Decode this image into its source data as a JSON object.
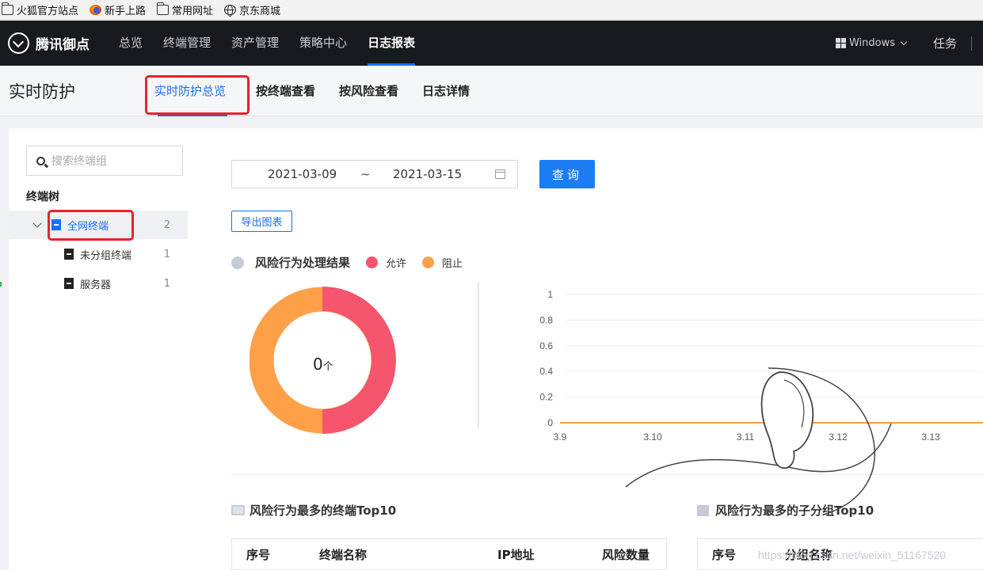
{
  "bookmarks": [
    {
      "label": "火狐官方站点",
      "icon": "folder-icon"
    },
    {
      "label": "新手上路",
      "icon": "firefox-icon"
    },
    {
      "label": "常用网址",
      "icon": "folder-icon"
    },
    {
      "label": "京东商城",
      "icon": "globe-icon"
    }
  ],
  "header": {
    "brand": "腾讯御点",
    "nav": [
      {
        "label": "总览"
      },
      {
        "label": "终端管理"
      },
      {
        "label": "资产管理"
      },
      {
        "label": "策略中心"
      },
      {
        "label": "日志报表",
        "active": true
      }
    ],
    "os_select": "Windows",
    "task": "任务"
  },
  "subheader": {
    "title": "实时防护",
    "tabs": [
      {
        "label": "实时防护总览",
        "active": true
      },
      {
        "label": "按终端查看"
      },
      {
        "label": "按风险查看"
      },
      {
        "label": "日志详情"
      }
    ]
  },
  "sidebar": {
    "search_placeholder": "搜索终端组",
    "tree_title": "终端树",
    "nodes": [
      {
        "label": "全网终端",
        "count": "2",
        "selected": true
      },
      {
        "label": "未分组终端",
        "count": "1"
      },
      {
        "label": "服务器",
        "count": "1"
      }
    ]
  },
  "filters": {
    "start_date": "2021-03-09",
    "separator": "~",
    "end_date": "2021-03-15",
    "query_label": "查询",
    "export_label": "导出图表"
  },
  "risk_section": {
    "title": "风险行为处理结果",
    "legend": [
      {
        "label": "允许",
        "color": "#f5556d"
      },
      {
        "label": "阻止",
        "color": "#fda047"
      }
    ],
    "donut_value": "0",
    "donut_unit": "个"
  },
  "chart_data": {
    "type": "line",
    "x": [
      "3.9",
      "3.10",
      "3.11",
      "3.12",
      "3.13"
    ],
    "series": [
      {
        "values": [
          0,
          0,
          0,
          0,
          0
        ],
        "color": "#fda047"
      }
    ],
    "yticks": [
      "1",
      "0.8",
      "0.6",
      "0.4",
      "0.2",
      "0"
    ],
    "ylim": [
      0,
      1
    ],
    "grid": true
  },
  "top_terminals": {
    "title": "风险行为最多的终端Top10",
    "columns": [
      "序号",
      "终端名称",
      "IP地址",
      "风险数量"
    ]
  },
  "top_groups": {
    "title": "风险行为最多的子分组Top10",
    "columns": [
      "序号",
      "分组名称"
    ]
  },
  "watermark": "https://blog.csdn.net/weixin_51167520"
}
